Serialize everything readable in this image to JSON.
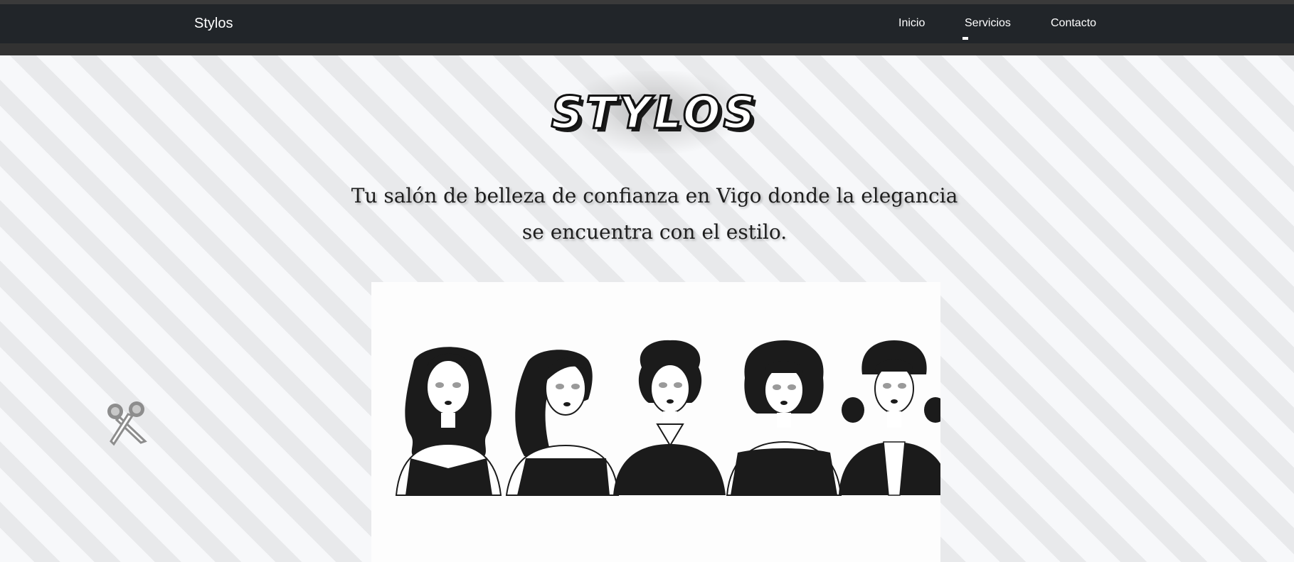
{
  "navbar": {
    "brand": "Stylos",
    "links": [
      {
        "label": "Inicio",
        "active": false
      },
      {
        "label": "Servicios",
        "active": true
      },
      {
        "label": "Contacto",
        "active": false
      }
    ]
  },
  "hero": {
    "logo_text": "STYLOS",
    "tagline_line1": "Tu salón de belleza de confianza en Vigo donde la elegancia",
    "tagline_line2": "se encuentra con el estilo.",
    "image_icon": "five-women-hairstyles-illustration",
    "decor_icon": "scissors-icon"
  },
  "colors": {
    "navbar_bg": "#212529",
    "nav_text": "#ffffff",
    "stripe_light": "#f7f8fa",
    "stripe_dark": "#e8e9eb"
  }
}
